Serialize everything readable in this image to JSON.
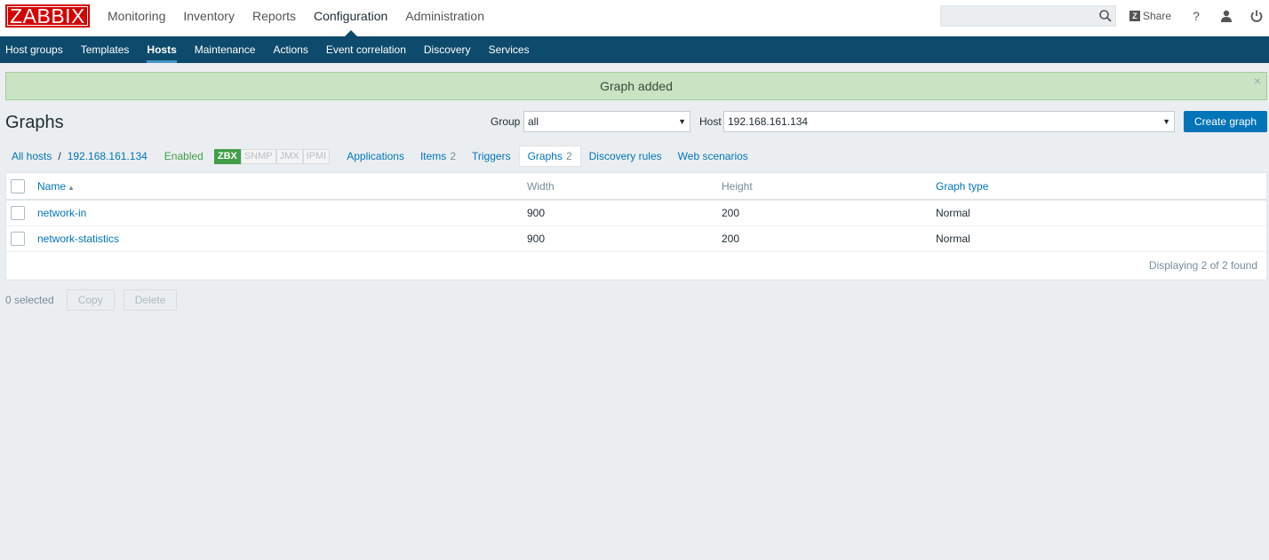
{
  "header": {
    "logo": "ZABBIX",
    "menu": [
      {
        "label": "Monitoring",
        "active": false
      },
      {
        "label": "Inventory",
        "active": false
      },
      {
        "label": "Reports",
        "active": false
      },
      {
        "label": "Configuration",
        "active": true
      },
      {
        "label": "Administration",
        "active": false
      }
    ],
    "search_value": "",
    "share_label": "Share",
    "help_label": "?"
  },
  "subnav": [
    {
      "label": "Host groups",
      "active": false
    },
    {
      "label": "Templates",
      "active": false
    },
    {
      "label": "Hosts",
      "active": true
    },
    {
      "label": "Maintenance",
      "active": false
    },
    {
      "label": "Actions",
      "active": false
    },
    {
      "label": "Event correlation",
      "active": false
    },
    {
      "label": "Discovery",
      "active": false
    },
    {
      "label": "Services",
      "active": false
    }
  ],
  "message": {
    "text": "Graph added",
    "close": "×"
  },
  "page": {
    "title": "Graphs",
    "group_label": "Group",
    "group_value": "all",
    "host_label": "Host",
    "host_value": "192.168.161.134",
    "create_button": "Create graph"
  },
  "hostnav": {
    "all_hosts": "All hosts",
    "separator": "/",
    "host": "192.168.161.134",
    "status": "Enabled",
    "badges": [
      {
        "label": "ZBX",
        "on": true
      },
      {
        "label": "SNMP",
        "on": false
      },
      {
        "label": "JMX",
        "on": false
      },
      {
        "label": "IPMI",
        "on": false
      }
    ],
    "tabs": [
      {
        "label": "Applications",
        "count": "",
        "active": false
      },
      {
        "label": "Items",
        "count": "2",
        "active": false
      },
      {
        "label": "Triggers",
        "count": "",
        "active": false
      },
      {
        "label": "Graphs",
        "count": "2",
        "active": true
      },
      {
        "label": "Discovery rules",
        "count": "",
        "active": false
      },
      {
        "label": "Web scenarios",
        "count": "",
        "active": false
      }
    ]
  },
  "table": {
    "columns": [
      "Name",
      "Width",
      "Height",
      "Graph type"
    ],
    "rows": [
      {
        "name": "network-in",
        "width": "900",
        "height": "200",
        "type": "Normal"
      },
      {
        "name": "network-statistics",
        "width": "900",
        "height": "200",
        "type": "Normal"
      }
    ],
    "footer": "Displaying 2 of 2 found"
  },
  "actions": {
    "selected": "0 selected",
    "copy": "Copy",
    "delete": "Delete"
  },
  "colors": {
    "brand": "#d40000",
    "subnav_bg": "#0e4a6c",
    "link": "#0275b8",
    "success_bg": "#c9e3c3",
    "enabled": "#429e47"
  }
}
